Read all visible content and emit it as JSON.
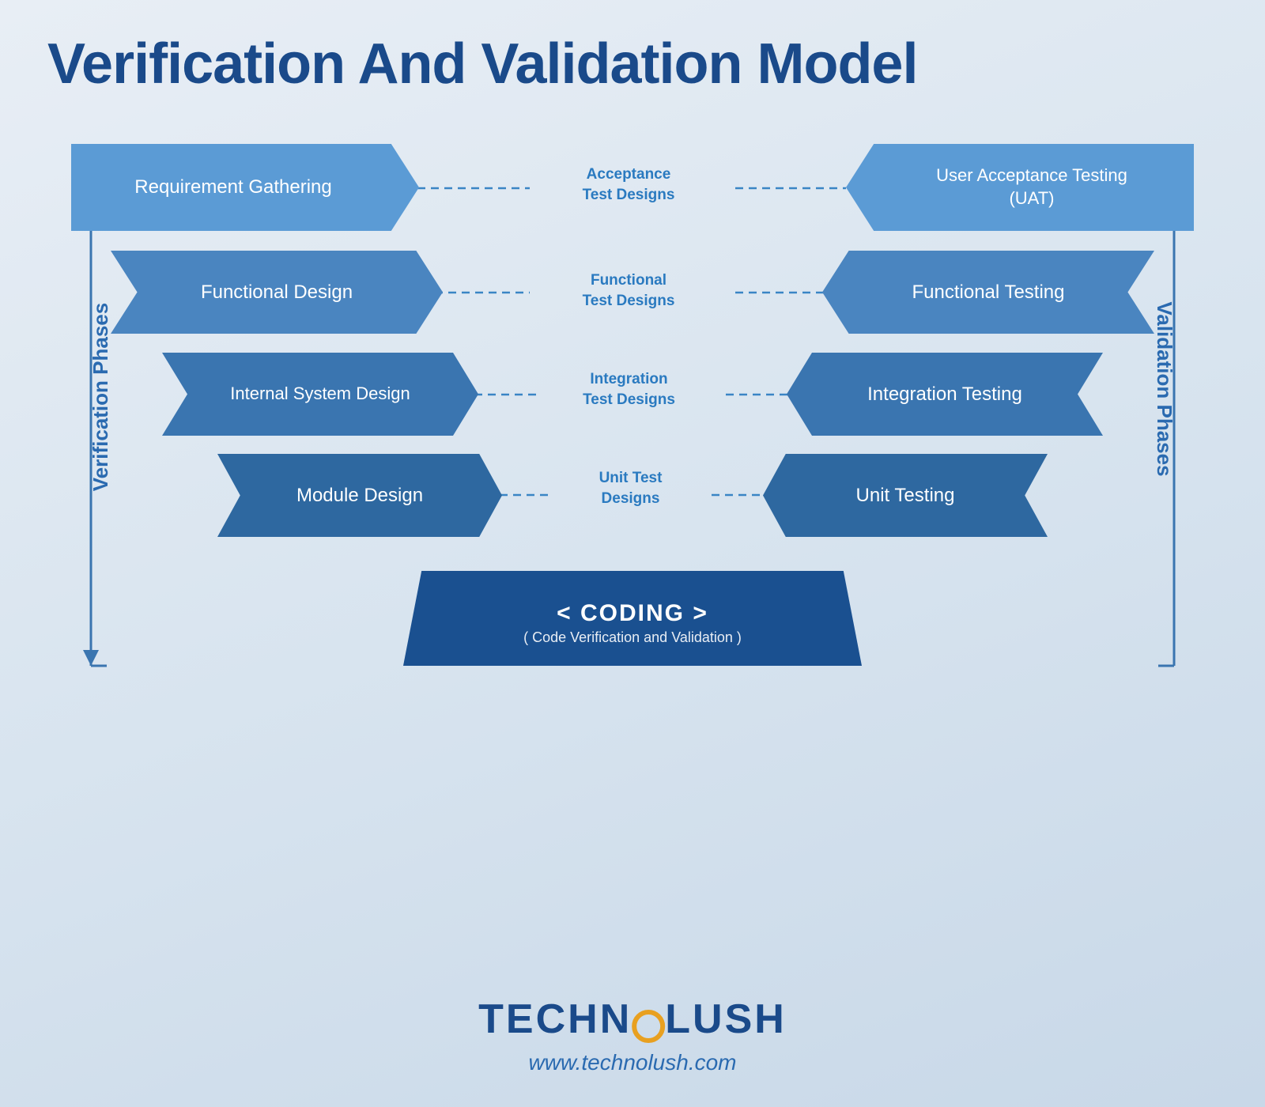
{
  "title": "Verification And Validation Model",
  "diagram": {
    "left_label": "Verification Phases",
    "right_label": "Validation Phases",
    "nodes": {
      "req_gathering": "Requirement Gathering",
      "func_design": "Functional Design",
      "internal_design": "Internal\nSystem Design",
      "module_design": "Module Design",
      "coding_main": "< CODING >",
      "coding_sub": "( Code Verification and Validation )",
      "unit_testing": "Unit Testing",
      "integration_testing": "Integration Testing",
      "func_testing": "Functional Testing",
      "uat": "User Acceptance Testing (UAT)"
    },
    "center_labels": {
      "acceptance": "Acceptance\nTest Designs",
      "functional": "Functional\nTest Designs",
      "integration": "Integration\nTest Designs",
      "unit": "Unit Test\nDesigns"
    }
  },
  "logo": {
    "text": "TECHNOLUSH",
    "url": "www.technolush.com"
  }
}
